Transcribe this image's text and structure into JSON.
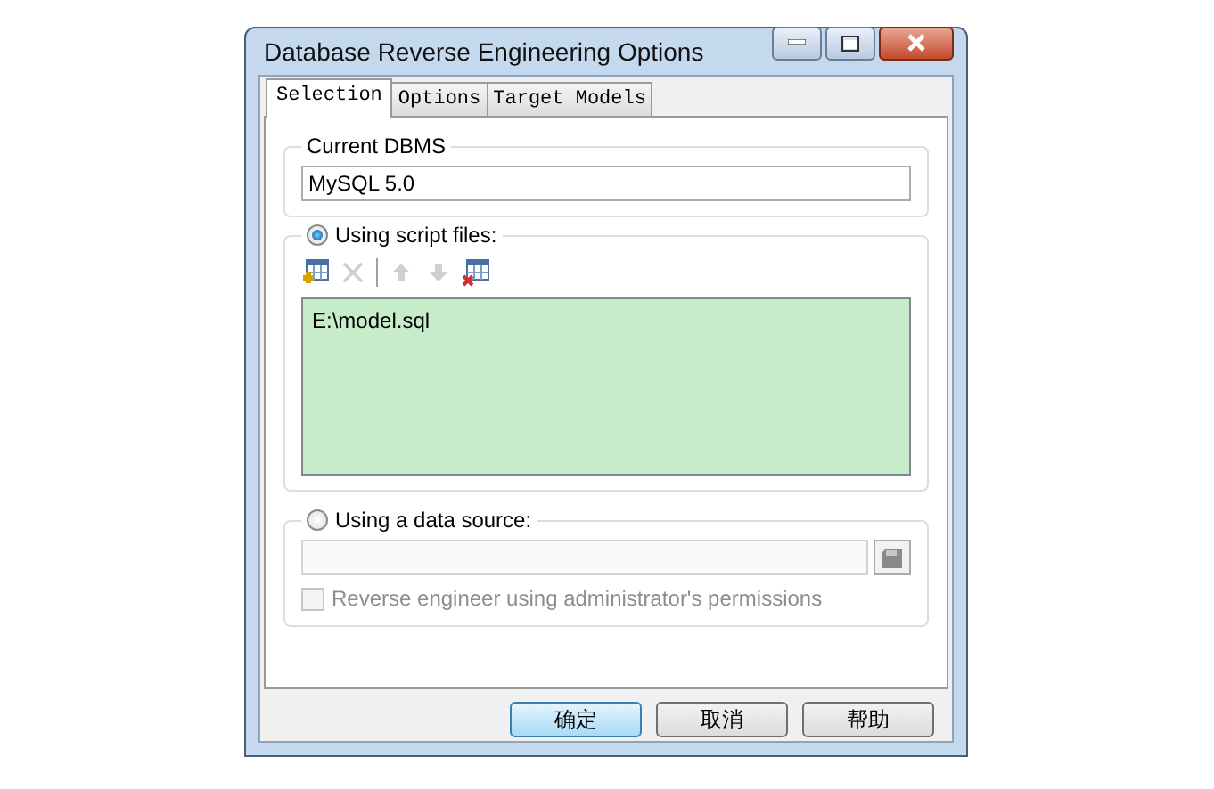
{
  "window": {
    "title": "Database Reverse Engineering Options"
  },
  "tabs": [
    {
      "label": "Selection",
      "selected": true
    },
    {
      "label": "Options",
      "selected": false
    },
    {
      "label": "Target Models",
      "selected": false
    }
  ],
  "current_dbms": {
    "label": "Current DBMS",
    "value": "MySQL 5.0"
  },
  "script_files": {
    "label": "Using script files:",
    "selected": true,
    "toolbar": [
      {
        "kind": "add",
        "disabled": false
      },
      {
        "kind": "delete",
        "disabled": true
      },
      {
        "kind": "up",
        "disabled": true
      },
      {
        "kind": "down",
        "disabled": true
      },
      {
        "kind": "clear",
        "disabled": false
      }
    ],
    "files": [
      "E:\\model.sql"
    ]
  },
  "data_source": {
    "label": "Using a data source:",
    "selected": false,
    "disabled": true,
    "admin_checkbox": {
      "label": "Reverse engineer using administrator's permissions",
      "checked": false,
      "disabled": true
    }
  },
  "buttons": [
    {
      "label": "确定",
      "default": true
    },
    {
      "label": "取消",
      "default": false
    },
    {
      "label": "帮助",
      "default": false
    }
  ]
}
